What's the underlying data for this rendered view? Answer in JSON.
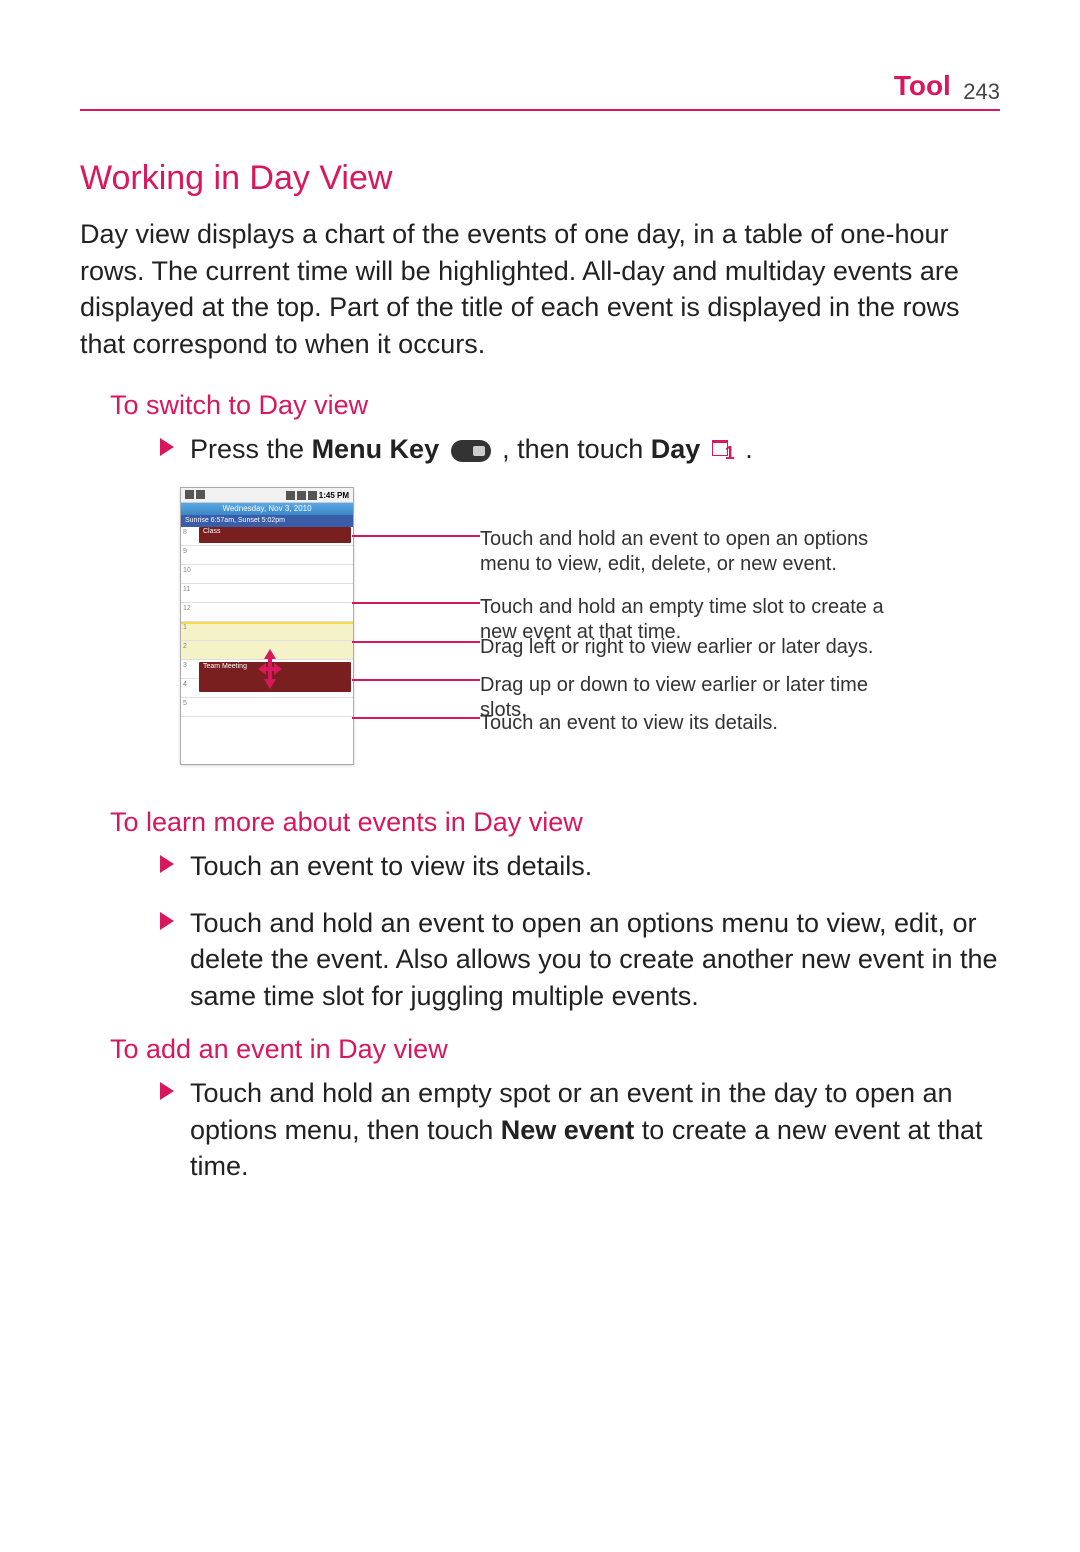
{
  "header": {
    "section": "Tool",
    "page": "243"
  },
  "h1": "Working in Day View",
  "intro": "Day view displays a chart of the events of one day, in a table of one-hour rows. The current time will be highlighted. All-day and multiday events are displayed at the top. Part of the title of each event is displayed in the rows that correspond to when it occurs.",
  "switch": {
    "heading": "To switch to Day view",
    "line_prefix": "Press the ",
    "menu_key_label": "Menu Key",
    "line_mid": " , then touch ",
    "day_label": "Day",
    "line_end": " ."
  },
  "phone": {
    "time": "1:45 PM",
    "date_bar": "Wednesday, Nov 3, 2010",
    "sunrise": "Sunrise 6:57am, Sunset 5:02pm",
    "hours": [
      "8",
      "9",
      "10",
      "11",
      "12",
      "1",
      "2",
      "3",
      "4",
      "5"
    ],
    "event1": "Class",
    "event2": "Team Meeting"
  },
  "callouts": {
    "c1": "Touch and hold an event to open an options menu to view, edit, delete, or new event.",
    "c2": "Touch and hold an empty time slot to create a new event at that time.",
    "c3": "Drag left or right to view earlier or later days.",
    "c4": "Drag up or down to view earlier or later time slots.",
    "c5": "Touch an event to view its details."
  },
  "learn": {
    "heading": "To learn more about events in Day view",
    "b1": "Touch an event to view its details.",
    "b2": "Touch and hold an event to open an options menu to view, edit, or delete the event. Also allows you to create another new event in the same time slot for juggling multiple events."
  },
  "add": {
    "heading": "To add an event in Day view",
    "b1_prefix": "Touch and hold an empty spot or an event in the day to open an options menu, then touch ",
    "b1_bold": "New event",
    "b1_suffix": " to create a new event at that time."
  }
}
